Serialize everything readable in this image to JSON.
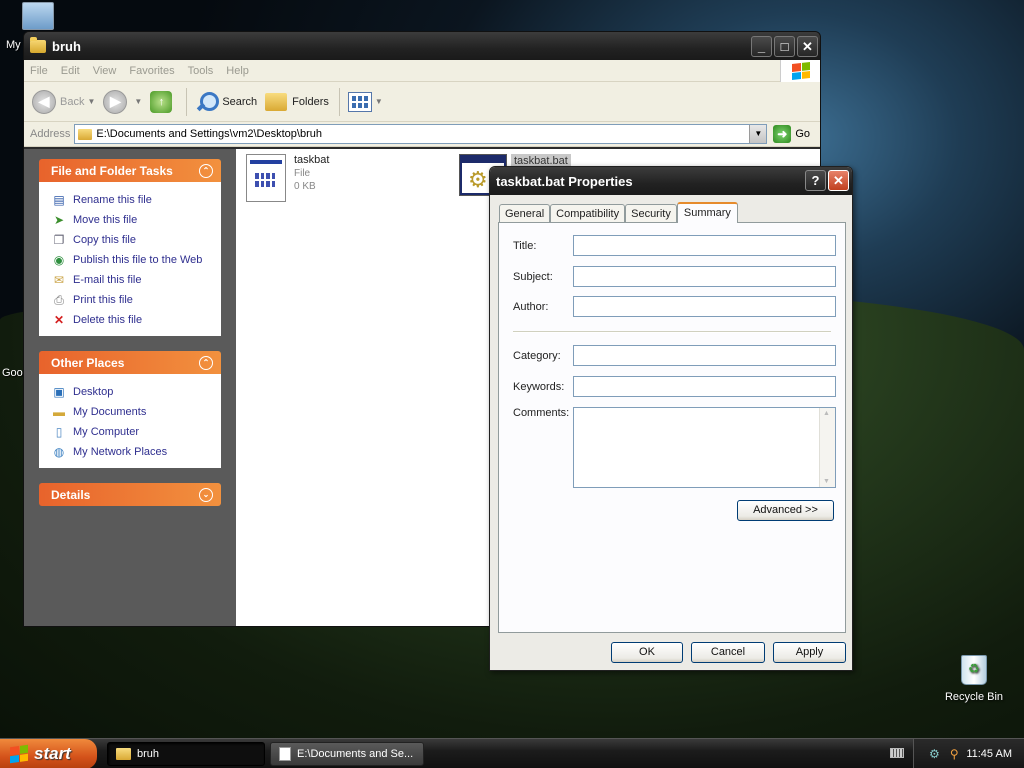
{
  "explorer": {
    "title": "bruh",
    "menu": [
      "File",
      "Edit",
      "View",
      "Favorites",
      "Tools",
      "Help"
    ],
    "toolbar": {
      "back": "Back",
      "search": "Search",
      "folders": "Folders"
    },
    "address": {
      "label": "Address",
      "path": "E:\\Documents and Settings\\vm2\\Desktop\\bruh",
      "go": "Go"
    },
    "file_tasks": {
      "title": "File and Folder Tasks",
      "items": [
        "Rename this file",
        "Move this file",
        "Copy this file",
        "Publish this file to the Web",
        "E-mail this file",
        "Print this file",
        "Delete this file"
      ]
    },
    "other_places": {
      "title": "Other Places",
      "items": [
        "Desktop",
        "My Documents",
        "My Computer",
        "My Network Places"
      ]
    },
    "details": {
      "title": "Details"
    },
    "files": [
      {
        "name": "taskbat",
        "type": "File",
        "size": "0 KB"
      },
      {
        "name": "taskbat.bat"
      }
    ]
  },
  "dialog": {
    "title": "taskbat.bat Properties",
    "tabs": [
      "General",
      "Compatibility",
      "Security",
      "Summary"
    ],
    "active_tab": "Summary",
    "fields": {
      "title": "Title:",
      "subject": "Subject:",
      "author": "Author:",
      "category": "Category:",
      "keywords": "Keywords:",
      "comments": "Comments:"
    },
    "advanced": "Advanced >>",
    "ok": "OK",
    "cancel": "Cancel",
    "apply": "Apply"
  },
  "desktop": {
    "partial_labels": [
      "My",
      "Goo"
    ],
    "recycle_bin": "Recycle Bin"
  },
  "taskbar": {
    "start": "start",
    "items": [
      "bruh",
      "E:\\Documents and Se..."
    ],
    "clock": "11:45 AM"
  }
}
